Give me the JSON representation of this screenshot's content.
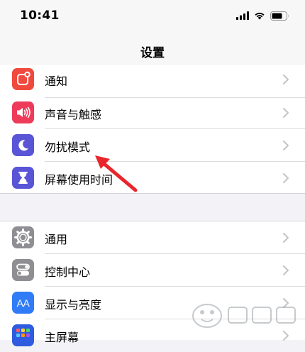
{
  "status_bar": {
    "time": "10:41"
  },
  "nav": {
    "title": "设置"
  },
  "group1": {
    "items": [
      {
        "label": "通知",
        "icon": "notification-icon",
        "color": "#f04a3e"
      },
      {
        "label": "声音与触感",
        "icon": "speaker-icon",
        "color": "#ef3b5a"
      },
      {
        "label": "勿扰模式",
        "icon": "moon-icon",
        "color": "#5a55d6"
      },
      {
        "label": "屏幕使用时间",
        "icon": "hourglass-icon",
        "color": "#5a55d6"
      }
    ]
  },
  "group2": {
    "items": [
      {
        "label": "通用",
        "icon": "gear-icon",
        "color": "#8e8e93"
      },
      {
        "label": "控制中心",
        "icon": "toggles-icon",
        "color": "#8e8e93"
      },
      {
        "label": "显示与亮度",
        "icon": "text-size-icon",
        "color": "#2f7cf6",
        "glyph": "AA"
      },
      {
        "label": "主屏幕",
        "icon": "home-screen-icon",
        "color": "#2f5be0"
      }
    ]
  },
  "colors": {
    "arrow": "#e8262b",
    "chevron": "#c4c4c7",
    "accent": "#2f7cf6"
  }
}
